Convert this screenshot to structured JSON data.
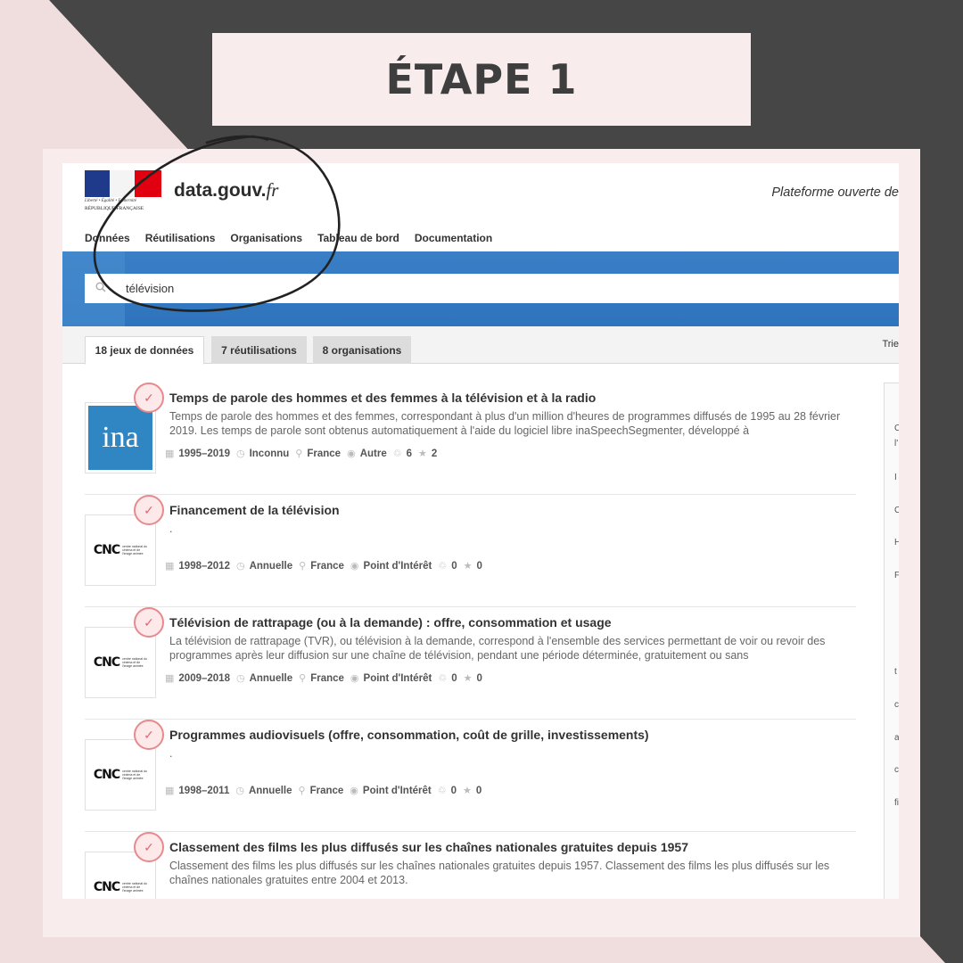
{
  "title": "ÉTAPE 1",
  "site": {
    "brand": "data.gouv.",
    "brand_ext": "fr",
    "motto": "Liberté • Égalité • Fraternité",
    "republic": "RÉPUBLIQUE FRANÇAISE",
    "tagline": "Plateforme ouverte de"
  },
  "nav": [
    "Données",
    "Réutilisations",
    "Organisations",
    "Tableau de bord",
    "Documentation"
  ],
  "search": {
    "value": "télévision"
  },
  "tabs": [
    {
      "label": "18 jeux de données",
      "active": true
    },
    {
      "label": "7 réutilisations",
      "active": false
    },
    {
      "label": "8 organisations",
      "active": false
    }
  ],
  "sort_label": "Trie",
  "results": [
    {
      "logo": "ina",
      "title": "Temps de parole des hommes et des femmes à la télévision et à la radio",
      "description": "Temps de parole des hommes et des femmes, correspondant à plus d'un million d'heures de programmes diffusés de 1995 au 28 février 2019. Les temps de parole sont obtenus automatiquement à l'aide du logiciel libre inaSpeechSegmenter, développé à",
      "period": "1995–2019",
      "frequency": "Inconnu",
      "zone": "France",
      "granularity": "Autre",
      "reuses": "6",
      "stars": "2"
    },
    {
      "logo": "cnc",
      "title": "Financement de la télévision",
      "description": ".",
      "period": "1998–2012",
      "frequency": "Annuelle",
      "zone": "France",
      "granularity": "Point d'Intérêt",
      "reuses": "0",
      "stars": "0"
    },
    {
      "logo": "cnc",
      "title": "Télévision de rattrapage (ou à la demande) : offre, consommation et usage",
      "description": "La télévision de rattrapage (TVR), ou télévision à la demande, correspond à l'ensemble des services permettant de voir ou revoir des programmes après leur diffusion sur une chaîne de télévision, pendant une période déterminée, gratuitement ou sans",
      "period": "2009–2018",
      "frequency": "Annuelle",
      "zone": "France",
      "granularity": "Point d'Intérêt",
      "reuses": "0",
      "stars": "0"
    },
    {
      "logo": "cnc",
      "title": "Programmes audiovisuels (offre, consommation, coût de grille, investissements)",
      "description": ".",
      "period": "1998–2011",
      "frequency": "Annuelle",
      "zone": "France",
      "granularity": "Point d'Intérêt",
      "reuses": "0",
      "stars": "0"
    },
    {
      "logo": "cnc",
      "title": "Classement des films les plus diffusés sur les chaînes nationales gratuites depuis 1957",
      "description": "Classement des films les plus diffusés sur les chaînes nationales gratuites depuis 1957. Classement des films les plus diffusés sur les chaînes nationales gratuites entre 2004 et 2013.",
      "period": "",
      "frequency": "",
      "zone": "",
      "granularity": "",
      "reuses": "",
      "stars": ""
    }
  ],
  "logos": {
    "ina": "ina",
    "cnc": "CNC",
    "cnc_small": "centre national du cinéma et de l'image animée"
  },
  "side_letters": [
    "C",
    "l'",
    "I",
    "C",
    "H",
    "F",
    "t",
    "c",
    "a",
    "c",
    "fi"
  ],
  "colors": {
    "accent_blue": "#2e74bd",
    "badge": "#e8898d",
    "background": "#f0dede",
    "dark": "#464646"
  }
}
